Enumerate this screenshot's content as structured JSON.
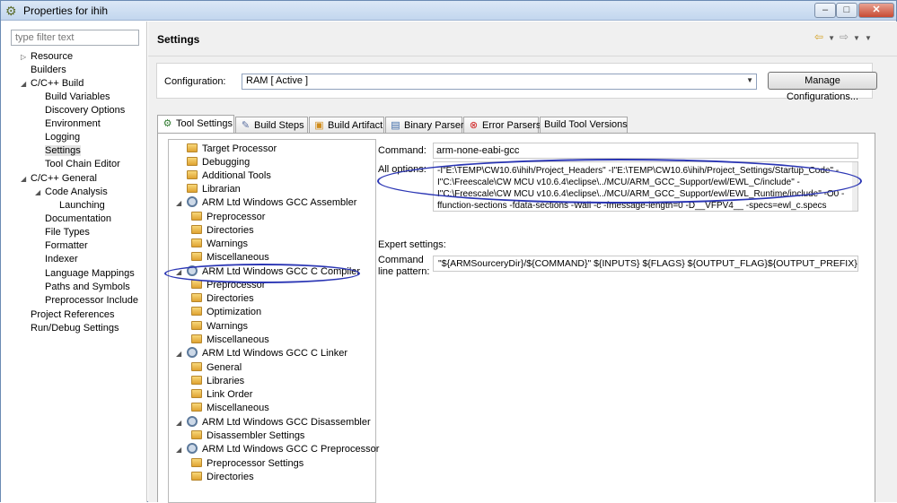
{
  "window": {
    "title": "Properties for ihih",
    "minimize": "–",
    "maximize": "□",
    "close": "✕"
  },
  "filter": {
    "placeholder": "type filter text"
  },
  "nav": [
    {
      "label": "Resource"
    },
    {
      "label": "Builders"
    },
    {
      "label": "C/C++ Build"
    },
    {
      "label": "Build Variables"
    },
    {
      "label": "Discovery Options"
    },
    {
      "label": "Environment"
    },
    {
      "label": "Logging"
    },
    {
      "label": "Settings"
    },
    {
      "label": "Tool Chain Editor"
    },
    {
      "label": "C/C++ General"
    },
    {
      "label": "Code Analysis"
    },
    {
      "label": "Launching"
    },
    {
      "label": "Documentation"
    },
    {
      "label": "File Types"
    },
    {
      "label": "Formatter"
    },
    {
      "label": "Indexer"
    },
    {
      "label": "Language Mappings"
    },
    {
      "label": "Paths and Symbols"
    },
    {
      "label": "Preprocessor Include Pa"
    },
    {
      "label": "Project References"
    },
    {
      "label": "Run/Debug Settings"
    }
  ],
  "page": {
    "title": "Settings"
  },
  "config": {
    "label": "Configuration:",
    "value": "RAM  [ Active ]",
    "manage": "Manage Configurations..."
  },
  "tabs": [
    "Tool Settings",
    "Build Steps",
    "Build Artifact",
    "Binary Parsers",
    "Error Parsers",
    "Build Tool Versions"
  ],
  "tree": [
    {
      "label": "Target Processor"
    },
    {
      "label": "Debugging"
    },
    {
      "label": "Additional Tools"
    },
    {
      "label": "Librarian"
    },
    {
      "label": "ARM Ltd Windows GCC Assembler"
    },
    {
      "label": "Preprocessor"
    },
    {
      "label": "Directories"
    },
    {
      "label": "Warnings"
    },
    {
      "label": "Miscellaneous"
    },
    {
      "label": "ARM Ltd Windows GCC C Compiler"
    },
    {
      "label": "Preprocessor"
    },
    {
      "label": "Directories"
    },
    {
      "label": "Optimization"
    },
    {
      "label": "Warnings"
    },
    {
      "label": "Miscellaneous"
    },
    {
      "label": "ARM Ltd Windows GCC C Linker"
    },
    {
      "label": "General"
    },
    {
      "label": "Libraries"
    },
    {
      "label": "Link Order"
    },
    {
      "label": "Miscellaneous"
    },
    {
      "label": "ARM Ltd Windows GCC Disassembler"
    },
    {
      "label": "Disassembler Settings"
    },
    {
      "label": "ARM Ltd Windows GCC C Preprocessor"
    },
    {
      "label": "Preprocessor Settings"
    },
    {
      "label": "Directories"
    }
  ],
  "settings": {
    "command_label": "Command:",
    "command_value": "arm-none-eabi-gcc",
    "alloptions_label": "All options:",
    "alloptions_value": "-I\"E:\\TEMP\\CW10.6\\ihih/Project_Headers\" -I\"E:\\TEMP\\CW10.6\\ihih/Project_Settings/Startup_Code\" -I\"C:\\Freescale\\CW MCU v10.6.4\\eclipse\\../MCU/ARM_GCC_Support/ewl/EWL_C/include\" -I\"C:\\Freescale\\CW MCU v10.6.4\\eclipse\\../MCU/ARM_GCC_Support/ewl/EWL_Runtime/include\" -O0 -ffunction-sections -fdata-sections -Wall -c -fmessage-length=0 -D__VFPV4__ -specs=ewl_c.specs",
    "expert_label": "Expert settings:",
    "pattern_label": "Command line pattern:",
    "pattern_value": "\"${ARMSourceryDir}/${COMMAND}\" ${INPUTS} ${FLAGS} ${OUTPUT_FLAG}${OUTPUT_PREFIX}${OUTPUT"
  }
}
